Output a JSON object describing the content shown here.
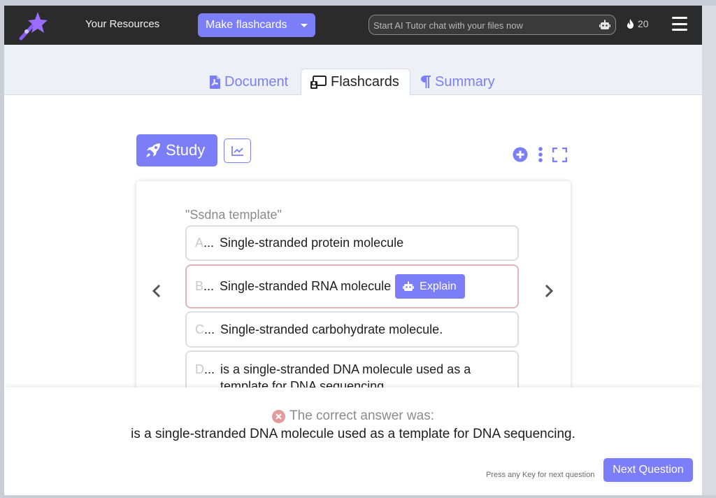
{
  "header": {
    "nav_resources": "Your Resources",
    "make_button": "Make flashcards",
    "search_placeholder": "Start AI Tutor chat with your files now",
    "streak_count": "20"
  },
  "tabs": [
    {
      "label": "Document",
      "icon": "pdf-file-icon",
      "active": false
    },
    {
      "label": "Flashcards",
      "icon": "flashcards-icon",
      "active": true
    },
    {
      "label": "Summary",
      "icon": "paragraph-icon",
      "active": false
    }
  ],
  "study": {
    "study_label": "Study"
  },
  "card": {
    "question": "\"Ssdna template\"",
    "options": [
      {
        "letter": "A",
        "dots": "...",
        "text": "Single-stranded protein molecule"
      },
      {
        "letter": "B",
        "dots": "...",
        "text": "Single-stranded RNA molecule",
        "state": "wrong"
      },
      {
        "letter": "C",
        "dots": "...",
        "text": "Single-stranded carbohydrate molecule."
      },
      {
        "letter": "D",
        "dots": "...",
        "text": "is a single-stranded DNA molecule used as a template for DNA sequencing"
      }
    ],
    "explain_label": "Explain"
  },
  "feedback": {
    "title": "The correct answer was:",
    "answer": "is a single-stranded DNA molecule used as a template for DNA sequencing.",
    "hint": "Press any Key for next question",
    "next_label": "Next Question"
  },
  "colors": {
    "accent": "#7b7ef7",
    "topbar": "#2b2b2b",
    "wrong_icon": "#e39a9a"
  }
}
